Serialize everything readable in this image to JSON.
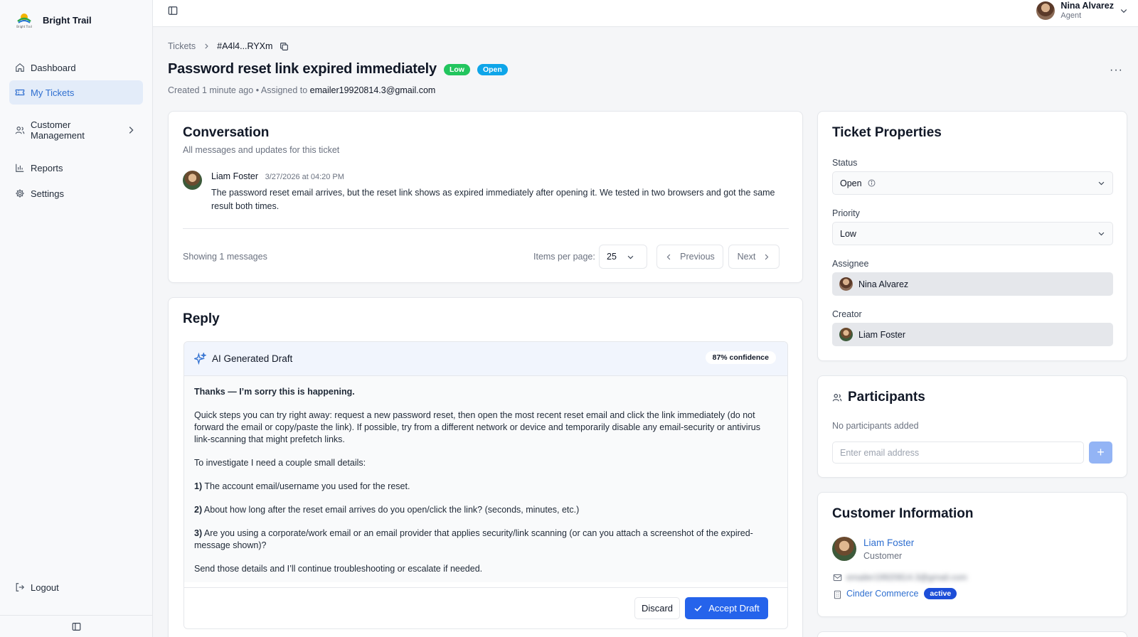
{
  "app": {
    "name": "Bright Trail"
  },
  "sidebar": {
    "items": [
      {
        "label": "Dashboard",
        "icon": "home-icon"
      },
      {
        "label": "My Tickets",
        "icon": "ticket-icon",
        "active": true
      },
      {
        "label": "Customer Management",
        "icon": "users-icon"
      },
      {
        "label": "Reports",
        "icon": "bar-chart-icon"
      },
      {
        "label": "Settings",
        "icon": "gear-icon"
      }
    ],
    "logout": "Logout"
  },
  "user": {
    "name": "Nina Alvarez",
    "role": "Agent"
  },
  "breadcrumb": {
    "parent": "Tickets",
    "id": "#A4l4...RYXm"
  },
  "ticket": {
    "title": "Password reset link expired immediately",
    "priority_badge": "Low",
    "status_badge": "Open",
    "created": "Created 1 minute ago",
    "assigned_prefix": "• Assigned to",
    "assigned_email": "emailer19920814.3@gmail.com"
  },
  "conversation": {
    "title": "Conversation",
    "subtitle": "All messages and updates for this ticket",
    "messages": [
      {
        "author": "Liam Foster",
        "time": "3/27/2026 at 04:20 PM",
        "text": "The password reset email arrives, but the reset link shows as expired immediately after opening it. We tested in two browsers and got the same result both times."
      }
    ],
    "showing": "Showing 1 messages",
    "items_per_page_label": "Items per page:",
    "items_per_page": "25",
    "previous": "Previous",
    "next": "Next"
  },
  "reply": {
    "title": "Reply",
    "draft_label": "AI Generated Draft",
    "confidence": "87% confidence",
    "opening": "Thanks — I’m sorry this is happening.",
    "paragraph1": "Quick steps you can try right away: request a new password reset, then open the most recent reset email and click the link immediately (do not forward the email or copy/paste the link). If possible, try from a different network or device and temporarily disable any email-security or antivirus link-scanning that might prefetch links.",
    "paragraph2": "To investigate I need a couple small details:",
    "q1_num": "1)",
    "q1": "The account email/username you used for the reset.",
    "q2_num": "2)",
    "q2": "About how long after the reset email arrives do you open/click the link? (seconds, minutes, etc.)",
    "q3_num": "3)",
    "q3": "Are you using a corporate/work email or an email provider that applies security/link scanning (or can you attach a screenshot of the expired-message shown)?",
    "closing": "Send those details and I’ll continue troubleshooting or escalate if needed.",
    "discard": "Discard",
    "accept": "Accept Draft"
  },
  "properties": {
    "title": "Ticket Properties",
    "status_label": "Status",
    "status_value": "Open",
    "priority_label": "Priority",
    "priority_value": "Low",
    "assignee_label": "Assignee",
    "assignee_value": "Nina Alvarez",
    "creator_label": "Creator",
    "creator_value": "Liam Foster"
  },
  "participants": {
    "title": "Participants",
    "empty": "No participants added",
    "placeholder": "Enter email address",
    "add": "+"
  },
  "customer": {
    "title": "Customer Information",
    "name": "Liam Foster",
    "role": "Customer",
    "email_blurred": "emailer19920814.3@gmail.com",
    "company": "Cinder Commerce",
    "company_status": "active"
  },
  "colors": {
    "accent": "#2563eb",
    "active_nav_bg": "#e3ecf9",
    "low_badge": "#22c55e",
    "open_badge": "#0ea5e9"
  }
}
